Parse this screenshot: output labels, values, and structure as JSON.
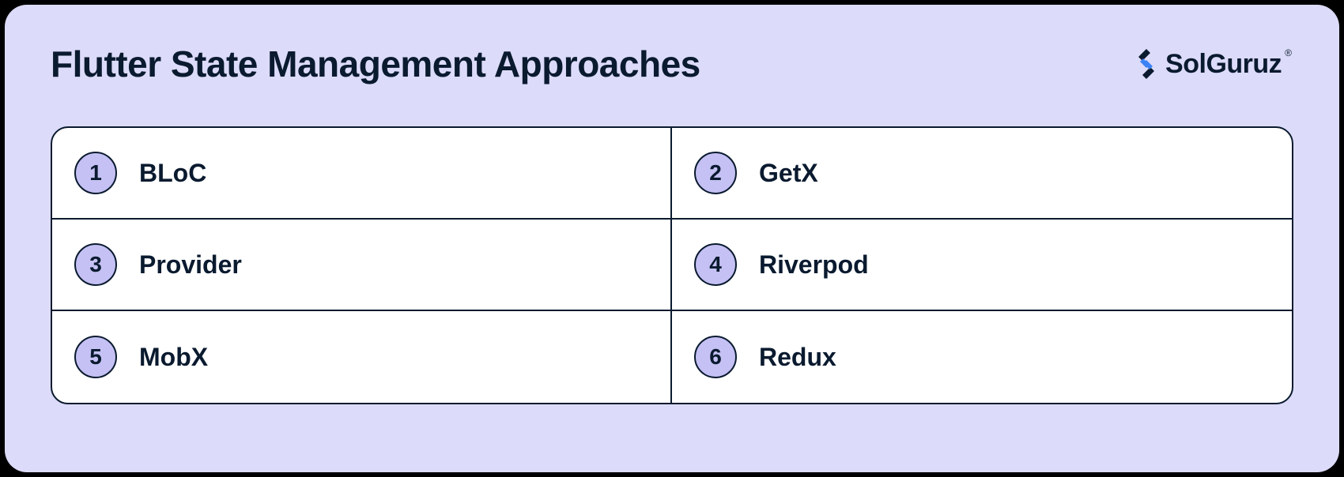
{
  "title": "Flutter State Management Approaches",
  "brand": {
    "name": "SolGuruz",
    "registered": "®"
  },
  "items": [
    {
      "num": "1",
      "label": "BLoC"
    },
    {
      "num": "2",
      "label": "GetX"
    },
    {
      "num": "3",
      "label": "Provider"
    },
    {
      "num": "4",
      "label": "Riverpod"
    },
    {
      "num": "5",
      "label": "MobX"
    },
    {
      "num": "6",
      "label": "Redux"
    }
  ]
}
